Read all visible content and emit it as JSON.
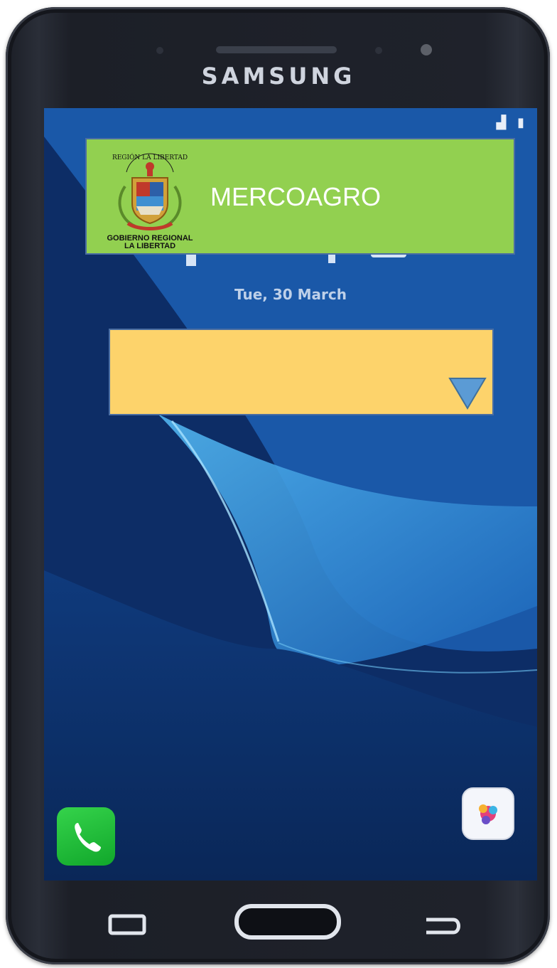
{
  "device": {
    "brand": "SAMSUNG"
  },
  "status_bar": {
    "icons": [
      "signal-icon",
      "battery-icon"
    ]
  },
  "lockscreen": {
    "date": "Tue, 30 March"
  },
  "header": {
    "title": "MERCOAGRO",
    "logo": {
      "arc_text": "REGIÓN LA LIBERTAD",
      "caption_line1": "GOBIERNO REGIONAL",
      "caption_line2": "LA LIBERTAD"
    },
    "background": "#92d050"
  },
  "dropdown": {
    "selected_value": "",
    "background": "#fdd36b",
    "arrow_color": "#5b9bd5"
  },
  "dock": {
    "left_app": "phone-icon",
    "right_app": "gallery-icon"
  },
  "navigation": {
    "buttons": [
      "recent-apps-icon",
      "home-button",
      "back-icon"
    ]
  }
}
